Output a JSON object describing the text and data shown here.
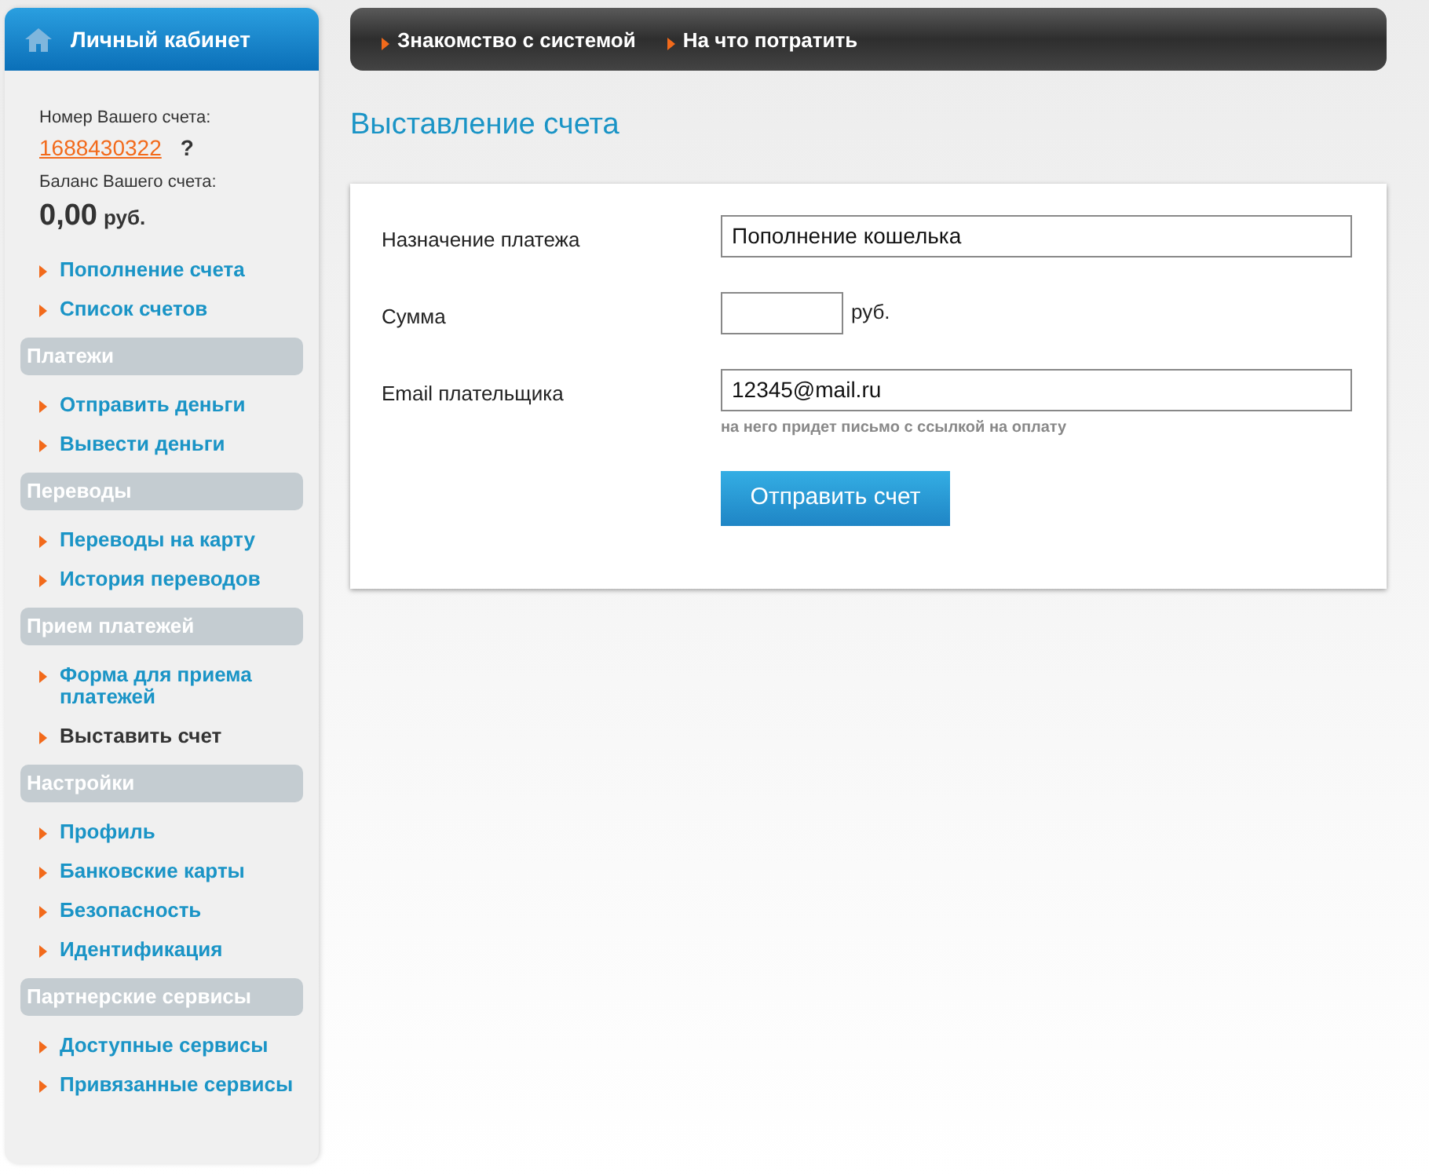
{
  "sidebar": {
    "title": "Личный кабинет",
    "account_label": "Номер Вашего счета:",
    "account_number": "1688430322",
    "help": "?",
    "balance_label": "Баланс Вашего счета:",
    "balance_amount": "0,00",
    "balance_currency": "руб.",
    "top_items": [
      {
        "label": "Пополнение счета",
        "selected": false
      },
      {
        "label": "Список счетов",
        "selected": false
      }
    ],
    "sections": [
      {
        "title": "Платежи",
        "items": [
          {
            "label": "Отправить деньги",
            "selected": false
          },
          {
            "label": "Вывести деньги",
            "selected": false
          }
        ]
      },
      {
        "title": "Переводы",
        "items": [
          {
            "label": "Переводы на карту",
            "selected": false
          },
          {
            "label": "История переводов",
            "selected": false
          }
        ]
      },
      {
        "title": "Прием платежей",
        "items": [
          {
            "label": "Форма для приема платежей",
            "selected": false
          },
          {
            "label": "Выставить счет",
            "selected": true
          }
        ]
      },
      {
        "title": "Настройки",
        "items": [
          {
            "label": "Профиль",
            "selected": false
          },
          {
            "label": "Банковские карты",
            "selected": false
          },
          {
            "label": "Безопасность",
            "selected": false
          },
          {
            "label": "Идентификация",
            "selected": false
          }
        ]
      },
      {
        "title": "Партнерские сервисы",
        "items": [
          {
            "label": "Доступные сервисы",
            "selected": false
          },
          {
            "label": "Привязанные сервисы",
            "selected": false
          }
        ]
      }
    ]
  },
  "topnav": [
    "Знакомство с системой",
    "На что потратить"
  ],
  "page_title": "Выставление счета",
  "form": {
    "fields": [
      {
        "label": "Назначение платежа",
        "value": "Пополнение кошелька",
        "kind": "wide"
      },
      {
        "label": "Сумма",
        "kind": "amount",
        "suffix": "руб."
      },
      {
        "label": "Email плательщика",
        "value": "12345@mail.ru",
        "kind": "wide",
        "hint": "на него придет письмо с ссылкой на оплату"
      }
    ],
    "submit": "Отправить счет"
  }
}
